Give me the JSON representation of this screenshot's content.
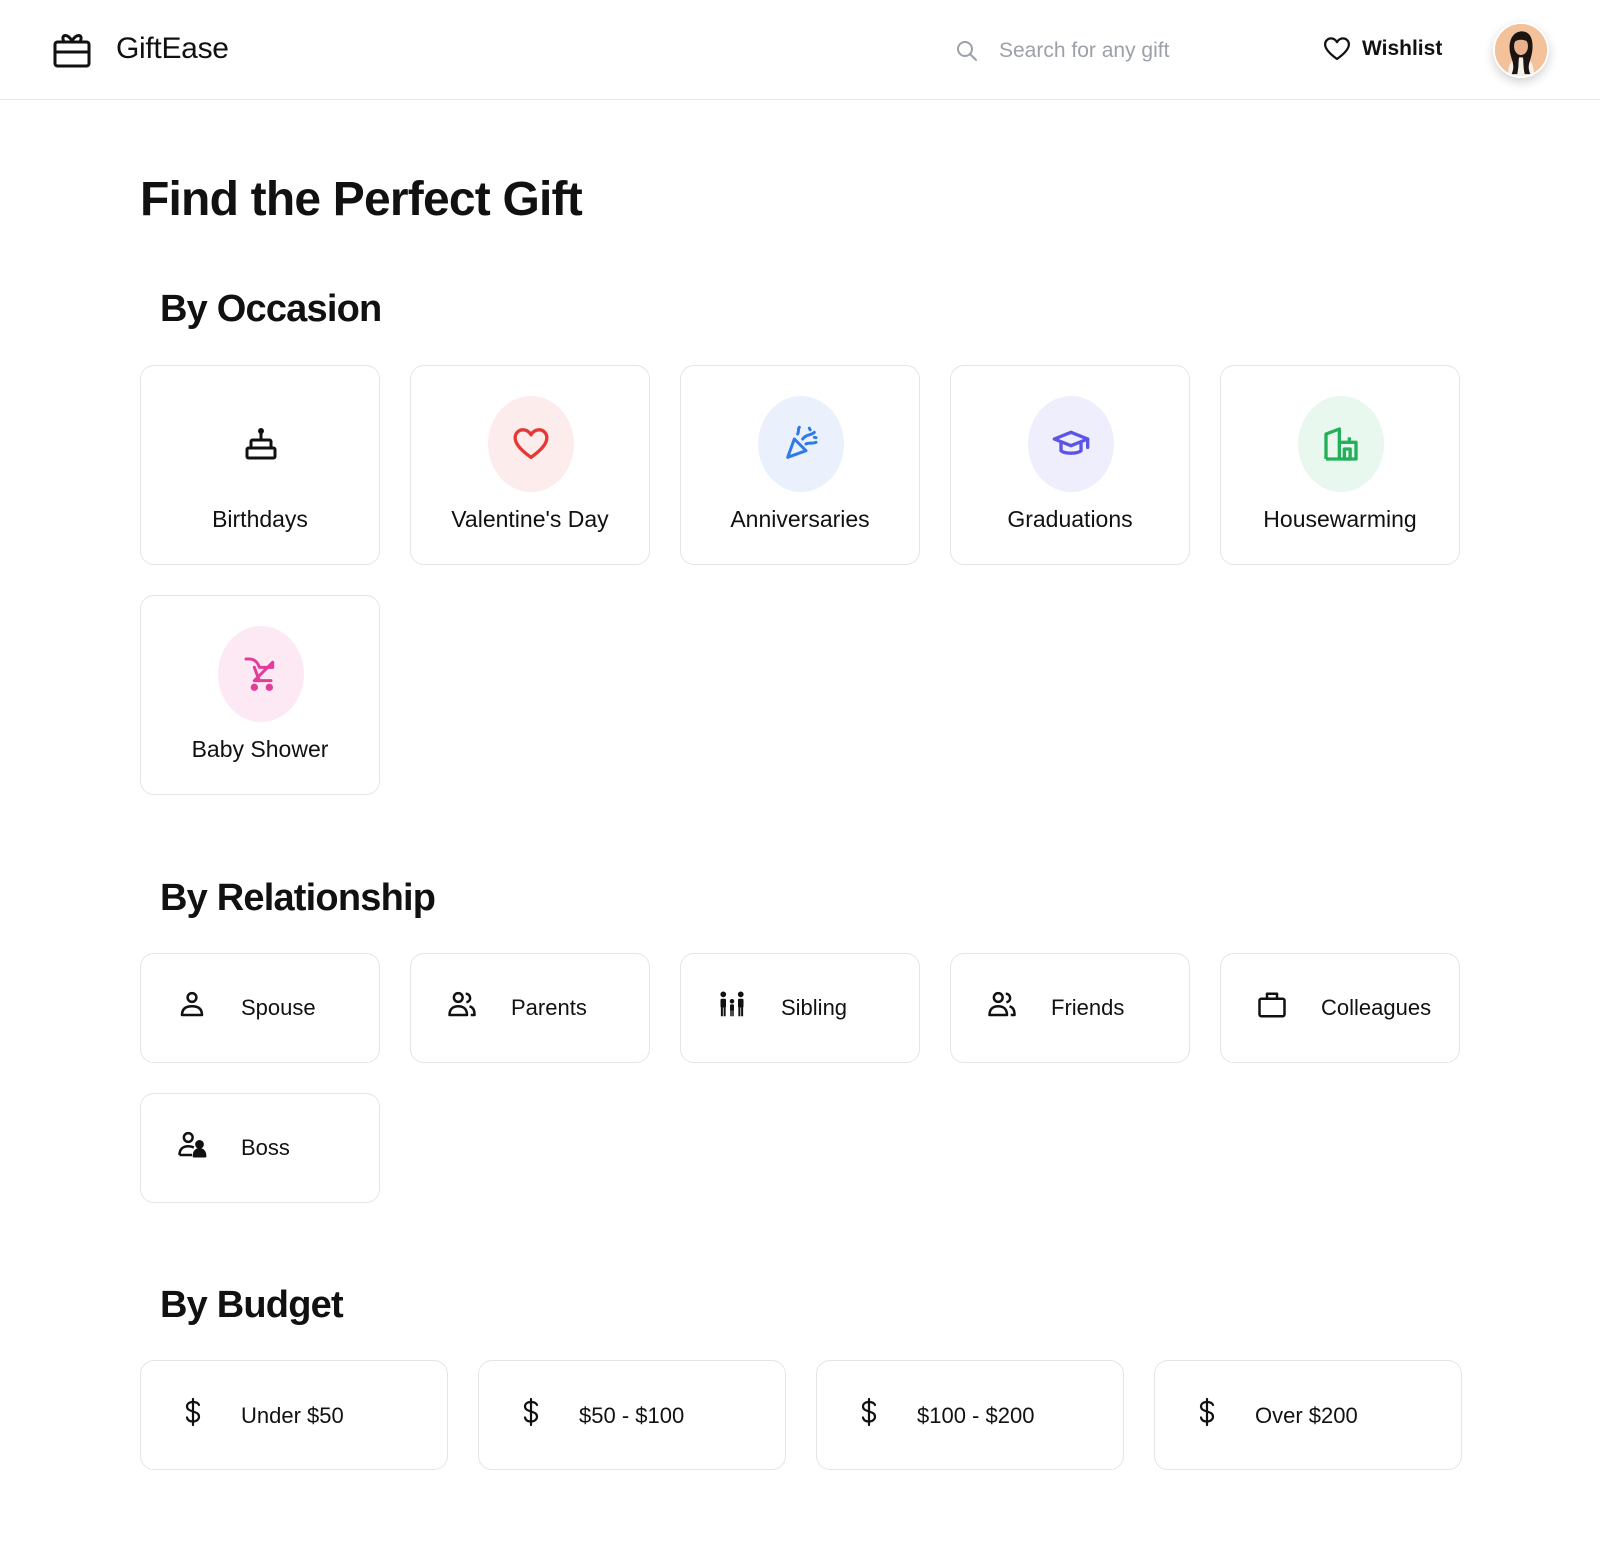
{
  "header": {
    "brand": "GiftEase",
    "search_placeholder": "Search for any gift",
    "wishlist_label": "Wishlist"
  },
  "page_title": "Find the Perfect Gift",
  "occasion": {
    "title": "By Occasion",
    "items": [
      {
        "label": "Birthdays",
        "icon": "cake-icon",
        "bg": "#ffffff",
        "color": "#111111"
      },
      {
        "label": "Valentine's Day",
        "icon": "heart-icon",
        "bg": "#fdecec",
        "color": "#e53935"
      },
      {
        "label": "Anniversaries",
        "icon": "party-popper-icon",
        "bg": "#eaf1fd",
        "color": "#2f7be6"
      },
      {
        "label": "Graduations",
        "icon": "graduation-cap-icon",
        "bg": "#eeeefd",
        "color": "#5b54e6"
      },
      {
        "label": "Housewarming",
        "icon": "house-icon",
        "bg": "#e9f8ee",
        "color": "#22b15a"
      },
      {
        "label": "Baby Shower",
        "icon": "stroller-icon",
        "bg": "#fde9f4",
        "color": "#e23d9b"
      }
    ]
  },
  "relationship": {
    "title": "By Relationship",
    "items": [
      {
        "label": "Spouse",
        "icon": "person-icon"
      },
      {
        "label": "Parents",
        "icon": "people-icon"
      },
      {
        "label": "Sibling",
        "icon": "family-icon"
      },
      {
        "label": "Friends",
        "icon": "people-icon"
      },
      {
        "label": "Colleagues",
        "icon": "briefcase-icon"
      },
      {
        "label": "Boss",
        "icon": "user-tie-icon"
      }
    ]
  },
  "budget": {
    "title": "By Budget",
    "items": [
      {
        "label": "Under $50",
        "icon": "dollar-icon"
      },
      {
        "label": "$50 - $100",
        "icon": "dollar-icon"
      },
      {
        "label": "$100 - $200",
        "icon": "dollar-icon"
      },
      {
        "label": "Over $200",
        "icon": "dollar-icon"
      }
    ]
  }
}
